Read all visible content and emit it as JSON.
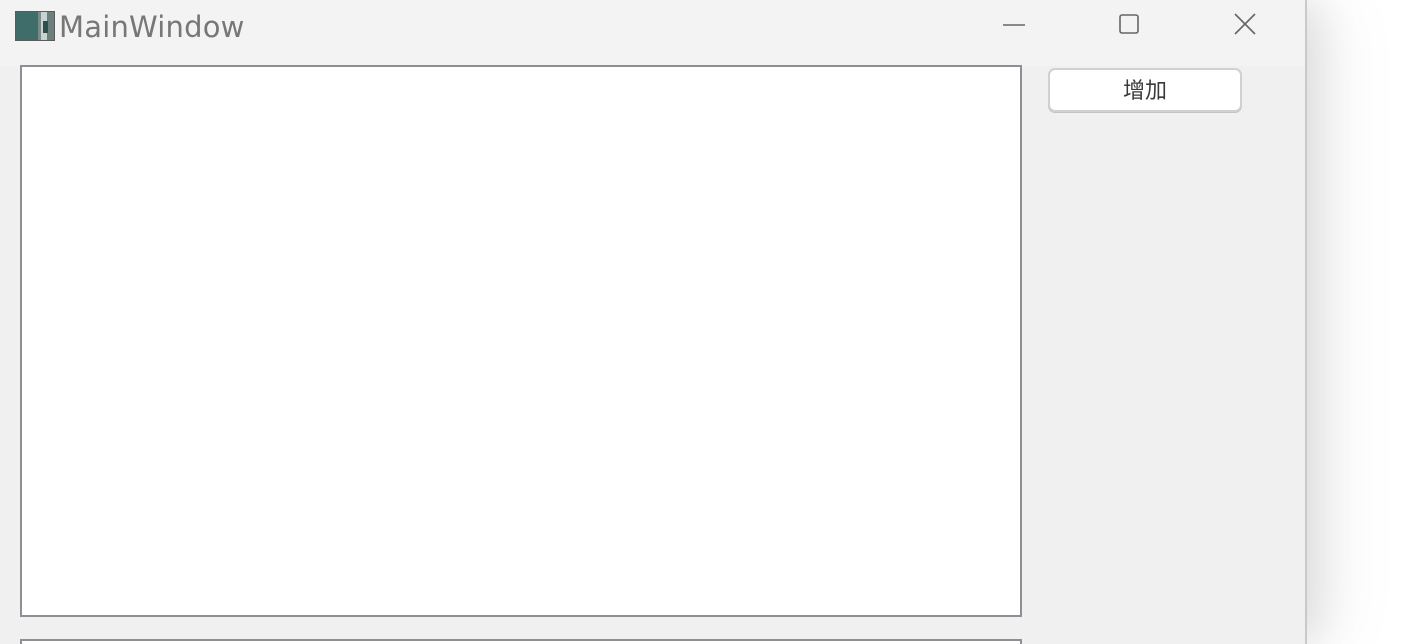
{
  "window": {
    "title": "MainWindow",
    "app_icon": "app-icon",
    "controls": {
      "minimize_icon": "minimize-icon",
      "maximize_icon": "maximize-icon",
      "close_icon": "close-icon"
    }
  },
  "main": {
    "add_button_label": "增加",
    "list_items": []
  },
  "colors": {
    "titlebar_bg": "#f3f3f3",
    "window_bg": "#f0f0f0",
    "panel_border": "#8c8f94",
    "button_bg": "#ffffff"
  }
}
